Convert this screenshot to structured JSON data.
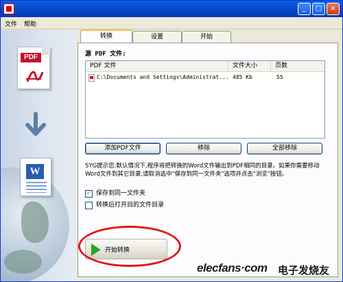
{
  "menu": {
    "file": "文件",
    "help": "帮助"
  },
  "tabs": [
    {
      "label": "转换",
      "active": true
    },
    {
      "label": "设置",
      "active": false
    },
    {
      "label": "开始",
      "active": false
    }
  ],
  "source_label": "源 PDF 文件:",
  "list": {
    "columns": [
      "PDF 文件",
      "文件大小",
      "页数"
    ],
    "rows": [
      {
        "file": "C:\\Documents and Settings\\Administrat...",
        "size": "485 Kb",
        "pages": "55"
      }
    ]
  },
  "buttons": {
    "add": "添加PDF文件",
    "remove": "移除",
    "remove_all": "全部移除"
  },
  "hint": "SYG提示您:默认情况下,程序将把转换的Word文件输出到PDF相同的目录。如果你需要移动Word文件到其它目录,请取消选中\"保存到同一文件夹\"选项并点击\"浏览\"按钮。",
  "options": [
    {
      "label": "保存到同一文件夹",
      "checked": true
    },
    {
      "label": "转换后打开目的文件目录",
      "checked": false
    }
  ],
  "start_button": "开始转换",
  "watermark": {
    "brand": "elecfans·com",
    "cn": "电子发烧友"
  },
  "icons": {
    "app": "app-icon",
    "pdf": "pdf-document-icon",
    "arrow": "arrow-down-icon",
    "word": "word-document-icon",
    "play": "play-icon"
  },
  "colors": {
    "accent_highlight": "#e01818",
    "title_bar": "#0848c8",
    "play": "#2aa52a"
  }
}
